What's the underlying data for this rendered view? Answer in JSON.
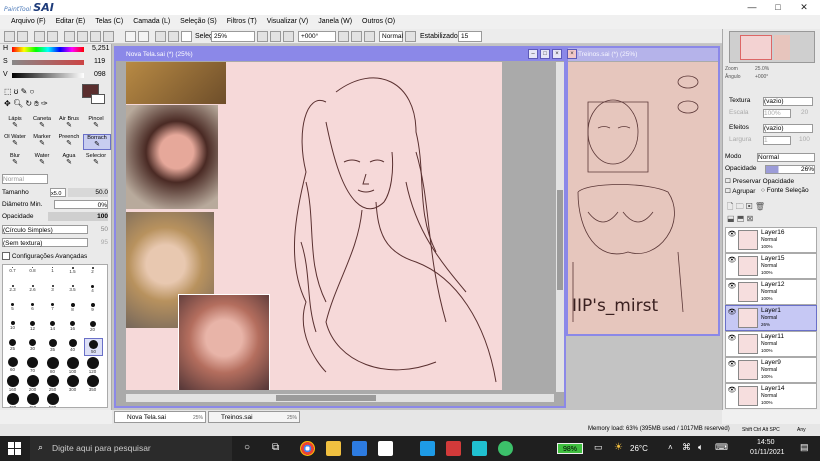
{
  "app": {
    "logo_small": "PaintTool",
    "logo_big": "SAI",
    "min_glyph": "—",
    "max_glyph": "□",
    "close_glyph": "✕"
  },
  "menu": [
    "Arquivo (F)",
    "Editar (E)",
    "Telas (C)",
    "Camada (L)",
    "Seleção (S)",
    "Filtros (T)",
    "Visualizar (V)",
    "Janela (W)",
    "Outros (O)"
  ],
  "toolbar": {
    "selecao_label": "Seleção",
    "zoom": "25%",
    "angle": "+000°",
    "mode": "Normal",
    "stabilizer_label": "Estabilizador",
    "stabilizer_value": "15"
  },
  "color": {
    "h_label": "H",
    "h_value": "5,251",
    "s_label": "S",
    "s_value": "119",
    "v_label": "V",
    "v_value": "098",
    "main_color": "#5a2e2e"
  },
  "tools": [
    {
      "name": "Lápis",
      "icon": "pencil-icon"
    },
    {
      "name": "Caneta",
      "icon": "pen-icon"
    },
    {
      "name": "Air Brus",
      "icon": "airbrush-icon"
    },
    {
      "name": "Pincel",
      "icon": "brush-icon"
    },
    {
      "name": "Ol Water",
      "icon": "oil-water-icon"
    },
    {
      "name": "Marker",
      "icon": "marker-icon"
    },
    {
      "name": "Preench",
      "icon": "fill-icon"
    },
    {
      "name": "Borrach",
      "icon": "eraser-icon"
    },
    {
      "name": "Blur",
      "icon": "blur-icon"
    },
    {
      "name": "Water",
      "icon": "water-icon"
    },
    {
      "name": "Água",
      "icon": "water-icon-2"
    },
    {
      "name": "Selecior",
      "icon": "selector-icon"
    }
  ],
  "brush": {
    "blend_mode": "Normal",
    "tamanho_label": "Tamanho",
    "tamanho_mult": "x5.0",
    "tamanho_value": "50.0",
    "diametro_label": "Diâmetro Min.",
    "diametro_value": "0%",
    "opacidade_label": "Opacidade",
    "opacidade_value": "100",
    "shape": "(Círculo Simples)",
    "shape_value": "50",
    "texture": "(Sem textura)",
    "texture_value": "95",
    "advanced_label": "Configurações Avançadas"
  },
  "brush_sizes": [
    "0.7",
    "0.8",
    "1",
    "1.5",
    "2",
    "2.3",
    "2.6",
    "3",
    "3.5",
    "4",
    "5",
    "6",
    "7",
    "8",
    "9",
    "10",
    "12",
    "14",
    "16",
    "20",
    "25",
    "30",
    "35",
    "40",
    "50",
    "60",
    "70",
    "80",
    "100",
    "120",
    "160",
    "200",
    "250",
    "300",
    "350",
    "400",
    "450",
    "500"
  ],
  "documents": {
    "main_title": "Nova Tela.sai (*) (25%)",
    "second_title": "Treinos.sai (*) (25%)",
    "second_text": "IIP's_mirst"
  },
  "navigator": {
    "zoom_label": "Zoom",
    "zoom_value": "25.0%",
    "angle_label": "Ângulo",
    "angle_value": "+000°"
  },
  "layer_props": {
    "textura_label": "Textura",
    "textura_value": "(vazio)",
    "escala_label": "Escala",
    "escala_value": "100%",
    "escala_num": "20",
    "efeitos_label": "Efeitos",
    "efeitos_value": "(vazio)",
    "largura_label": "Largura",
    "largura_value": "1",
    "largura_num": "100",
    "modo_label": "Modo",
    "modo_value": "Normal",
    "opacidade_label": "Opacidade",
    "opacidade_value": "26%",
    "preservar": "Preservar Opacidade",
    "agrupar": "Agrupar",
    "fonte": "Fonte Seleção"
  },
  "layers": [
    {
      "name": "Layer16",
      "mode": "Normal",
      "opacity": "100%",
      "selected": false
    },
    {
      "name": "Layer15",
      "mode": "Normal",
      "opacity": "100%",
      "selected": false
    },
    {
      "name": "Layer12",
      "mode": "Normal",
      "opacity": "100%",
      "selected": false
    },
    {
      "name": "Layer1",
      "mode": "Normal",
      "opacity": "26%",
      "selected": true
    },
    {
      "name": "Layer11",
      "mode": "Normal",
      "opacity": "100%",
      "selected": false
    },
    {
      "name": "Layer9",
      "mode": "Normal",
      "opacity": "100%",
      "selected": false
    },
    {
      "name": "Layer14",
      "mode": "Normal",
      "opacity": "100%",
      "selected": false
    }
  ],
  "doc_tabs": [
    {
      "name": "Nova Tela.sai",
      "zoom": "25%"
    },
    {
      "name": "Treinos.sai",
      "zoom": "25%"
    }
  ],
  "status": {
    "memory": "Memory load: 63% (395MB used / 1017MB reserved)",
    "keys": "Shift Ctrl Alt SPC",
    "any": "Any"
  },
  "taskbar": {
    "search_placeholder": "Digite aqui para pesquisar",
    "battery": "98%",
    "temperature": "26°C",
    "time": "14:50",
    "date": "01/11/2021"
  }
}
